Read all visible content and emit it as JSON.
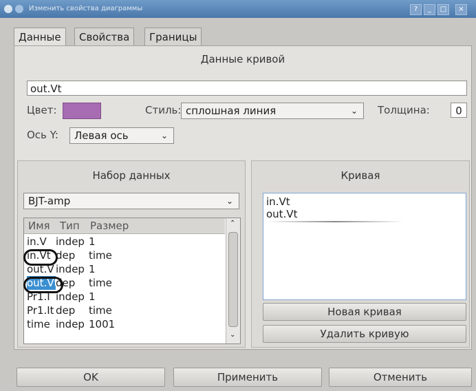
{
  "window": {
    "title": "Изменить свойства диаграммы",
    "controls": [
      "?",
      "_",
      "□",
      "×"
    ]
  },
  "tabs": [
    {
      "label": "Данные",
      "active": true
    },
    {
      "label": "Свойства",
      "active": false
    },
    {
      "label": "Границы",
      "active": false
    }
  ],
  "curve_data": {
    "title": "Данные кривой",
    "expression": "out.Vt",
    "color_label": "Цвет:",
    "color_value": "#a86cb3",
    "style_label": "Стиль:",
    "style_value": "сплошная линия",
    "thickness_label": "Толщина:",
    "thickness_value": "0",
    "axis_label": "Ось Y:",
    "axis_value": "Левая ось"
  },
  "dataset": {
    "title": "Набор данных",
    "selected": "BJT-amp",
    "columns": [
      "Имя",
      "Тип",
      "Размер"
    ],
    "rows": [
      {
        "name": "in.V",
        "type": "indep",
        "size": "1"
      },
      {
        "name": "in.Vt",
        "type": "dep",
        "size": "time"
      },
      {
        "name": "out.V",
        "type": "indep",
        "size": "1"
      },
      {
        "name": "out.Vt",
        "type": "dep",
        "size": "time"
      },
      {
        "name": "Pr1.I",
        "type": "indep",
        "size": "1"
      },
      {
        "name": "Pr1.It",
        "type": "dep",
        "size": "time"
      },
      {
        "name": "time",
        "type": "indep",
        "size": "1001"
      }
    ],
    "highlight_color": "#3a8fd1"
  },
  "curves": {
    "title": "Кривая",
    "items": [
      "in.Vt",
      "out.Vt"
    ],
    "new_button": "Новая кривая",
    "delete_button": "Удалить кривую"
  },
  "footer": {
    "ok": "OK",
    "apply": "Применить",
    "cancel": "Отменить"
  }
}
